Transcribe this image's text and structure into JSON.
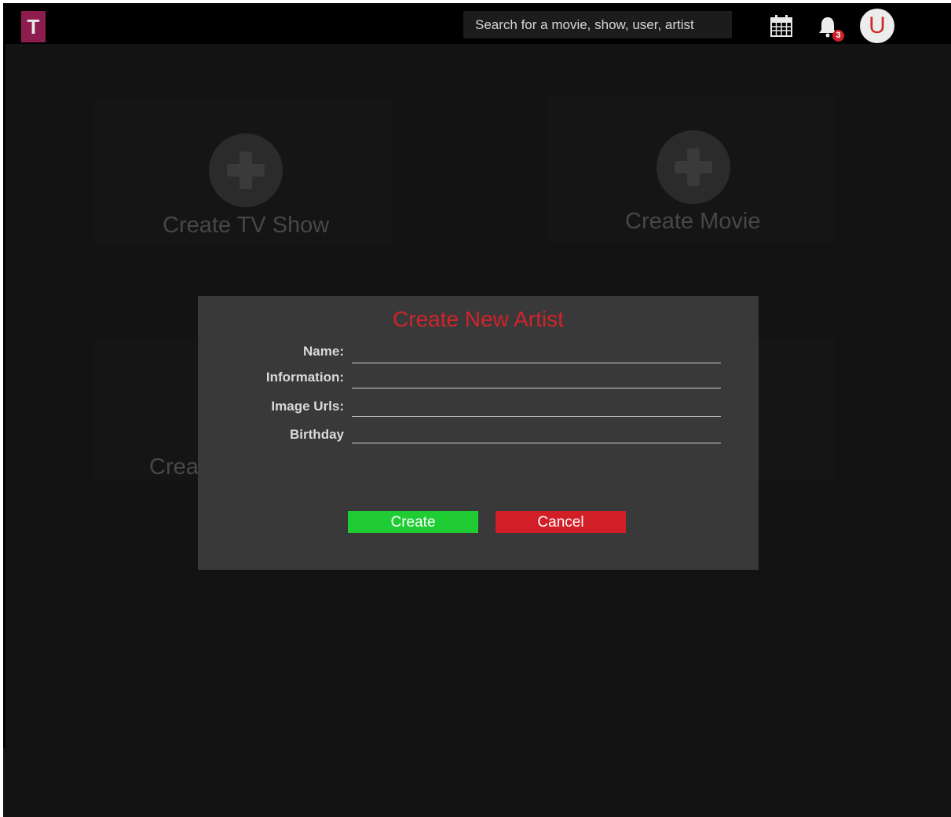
{
  "header": {
    "logo_letter": "T",
    "search_placeholder": "Search for a movie, show, user, artist",
    "notification_count": "3",
    "avatar_letter": "U"
  },
  "cards": {
    "tv_show": "Create TV Show",
    "movie": "Create Movie",
    "partial": "Crea"
  },
  "modal": {
    "title": "Create New Artist",
    "fields": {
      "name": "Name:",
      "information": "Information:",
      "image_urls": "Image Urls:",
      "birthday": "Birthday"
    },
    "create_label": "Create",
    "cancel_label": "Cancel"
  },
  "colors": {
    "title_red": "#d0242b",
    "create_green": "#20cc33",
    "cancel_red": "#d21f27",
    "logo_magenta": "#8e1d4f"
  }
}
